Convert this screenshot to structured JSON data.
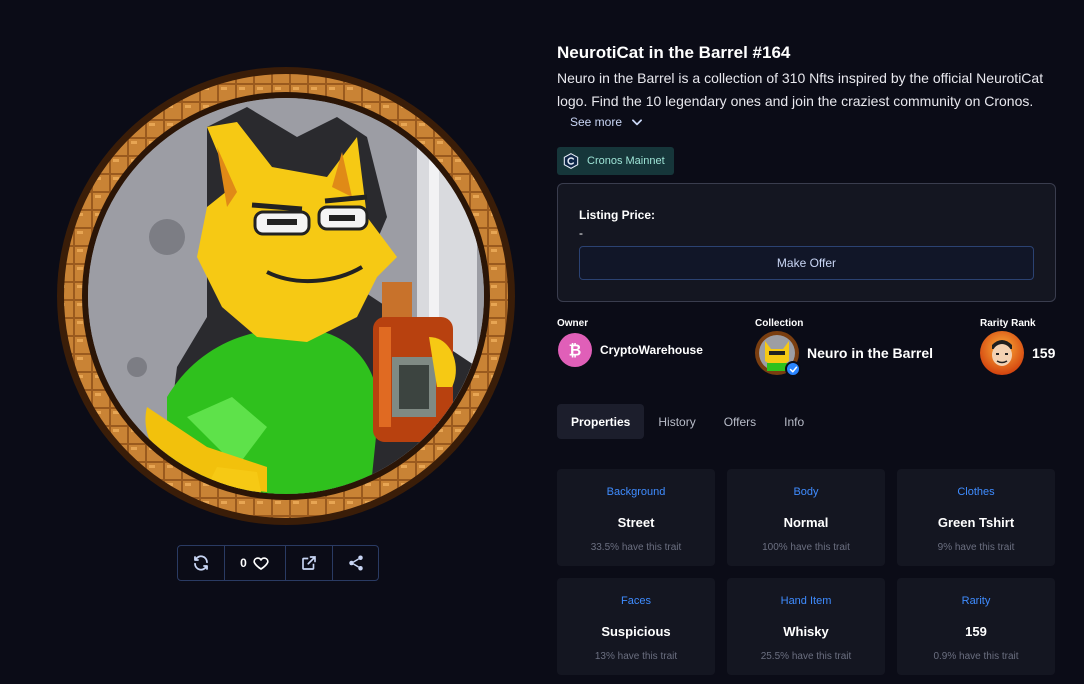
{
  "nft": {
    "title": "NeurotiCat in the Barrel #164",
    "description": "Neuro in the Barrel is a collection of 310 Nfts inspired by the official NeurotiCat logo. Find the 10 legendary ones and join the craziest community on Cronos.",
    "see_more_label": "See more",
    "chain": "Cronos Mainnet",
    "likes": "0"
  },
  "listing": {
    "label": "Listing Price:",
    "value": "-",
    "offer_button": "Make Offer"
  },
  "owner": {
    "label": "Owner",
    "name": "CryptoWarehouse"
  },
  "collection": {
    "label": "Collection",
    "name": "Neuro in the Barrel"
  },
  "rarity": {
    "label": "Rarity Rank",
    "value": "159"
  },
  "tabs": [
    {
      "label": "Properties",
      "active": true
    },
    {
      "label": "History",
      "active": false
    },
    {
      "label": "Offers",
      "active": false
    },
    {
      "label": "Info",
      "active": false
    }
  ],
  "traits": [
    {
      "type": "Background",
      "value": "Street",
      "pct": "33.5% have this trait"
    },
    {
      "type": "Body",
      "value": "Normal",
      "pct": "100% have this trait"
    },
    {
      "type": "Clothes",
      "value": "Green Tshirt",
      "pct": "9% have this trait"
    },
    {
      "type": "Faces",
      "value": "Suspicious",
      "pct": "13% have this trait"
    },
    {
      "type": "Hand Item",
      "value": "Whisky",
      "pct": "25.5% have this trait"
    },
    {
      "type": "Rarity",
      "value": "159",
      "pct": "0.9% have this trait"
    }
  ],
  "icons": {
    "refresh": "refresh-icon",
    "like": "heart-icon",
    "external": "external-link-icon",
    "share": "share-icon",
    "see_more": "chevron-down-icon",
    "chain": "cronos-icon",
    "owner": "bitcoin-icon",
    "verified": "verified-check-icon"
  },
  "colors": {
    "background": "#0b0c17",
    "accent_blue": "#3f8cff",
    "card": "#141621",
    "owner_avatar": "#e05fb8"
  }
}
